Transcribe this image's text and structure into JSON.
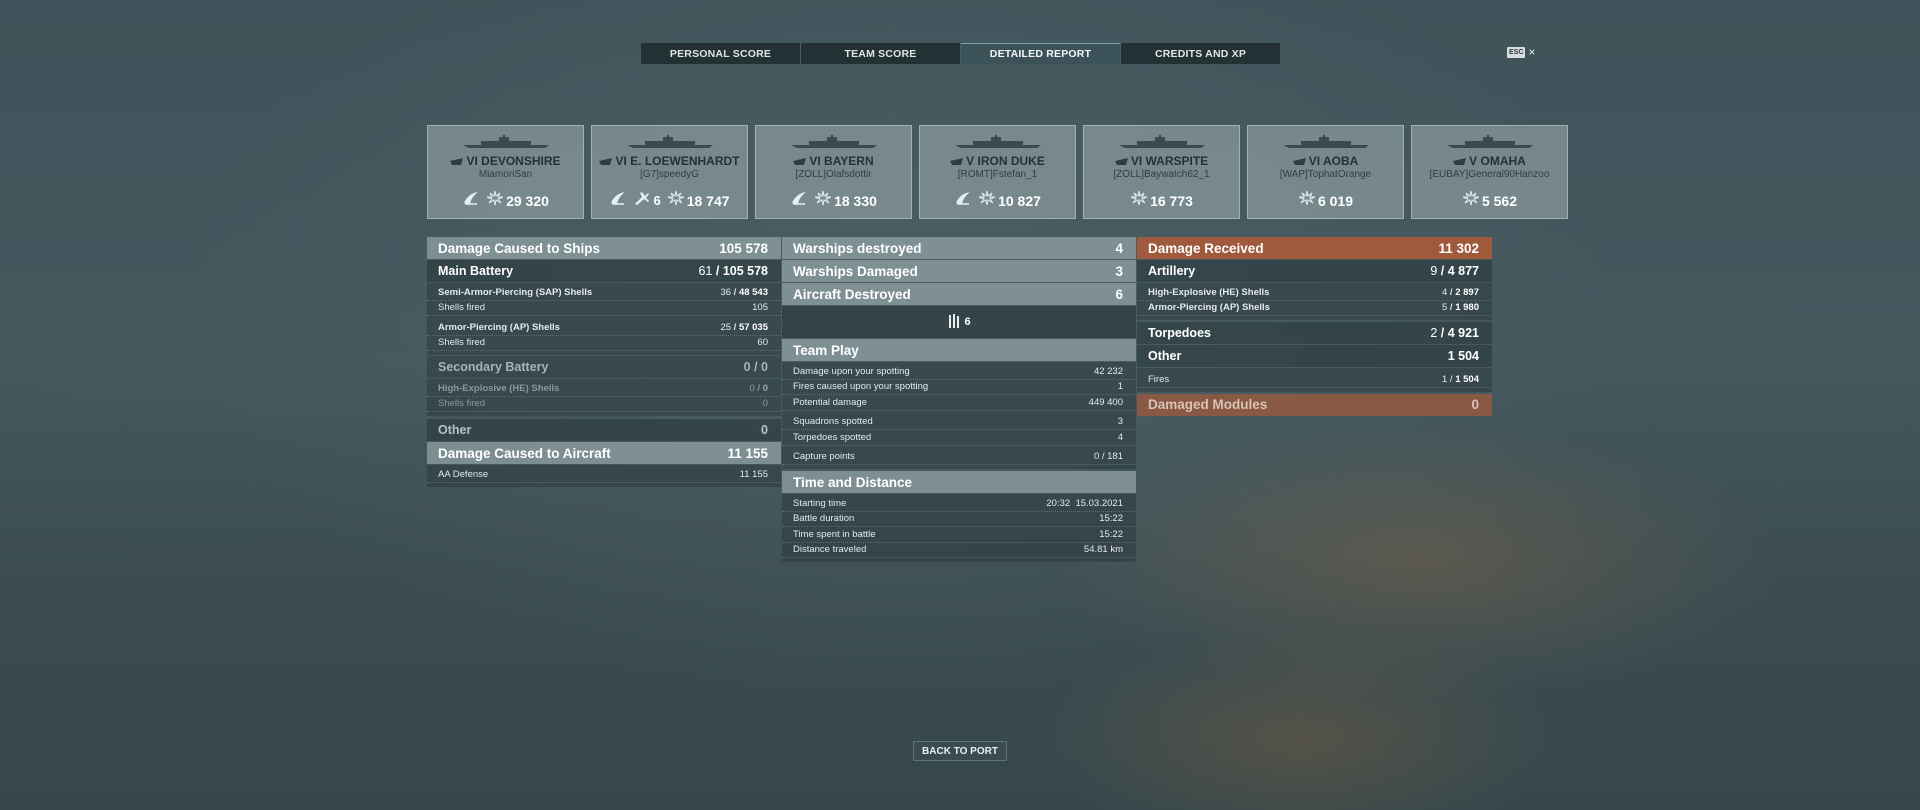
{
  "tabs": [
    "PERSONAL SCORE",
    "TEAM SCORE",
    "DETAILED REPORT",
    "CREDITS AND XP"
  ],
  "active_tab": 2,
  "esc_label": "ESC",
  "close_symbol": "×",
  "ships": [
    {
      "name": "VI DEVONSHIRE",
      "player": "MiamoriSan",
      "score": "29 320",
      "ribbons": [
        {
          "icon": "fire-icon",
          "count": ""
        }
      ]
    },
    {
      "name": "VI E. LOEWENHARDT",
      "player": "[G7]speedyG",
      "score": "18 747",
      "ribbons": [
        {
          "icon": "fire-icon",
          "count": ""
        },
        {
          "icon": "aircraft-icon",
          "count": "6"
        }
      ]
    },
    {
      "name": "VI BAYERN",
      "player": "[ZOLL]Olafsdottir",
      "score": "18 330",
      "ribbons": [
        {
          "icon": "fire-icon",
          "count": ""
        }
      ]
    },
    {
      "name": "V IRON DUKE",
      "player": "[ROMT]Fstefan_1",
      "score": "10 827",
      "ribbons": [
        {
          "icon": "fire-icon",
          "count": ""
        }
      ]
    },
    {
      "name": "VI WARSPITE",
      "player": "[ZOLL]Baywatch62_1",
      "score": "16 773",
      "ribbons": []
    },
    {
      "name": "VI AOBA",
      "player": "[WAP]TophatOrange",
      "score": "6 019",
      "ribbons": []
    },
    {
      "name": "V OMAHA",
      "player": "[EUBAY]General90Hanzoo",
      "score": "5 562",
      "ribbons": []
    }
  ],
  "damage_ships": {
    "label": "Damage Caused to Ships",
    "value": "105 578",
    "main_battery": {
      "label": "Main Battery",
      "hits": "61",
      "dmg": "105 578"
    },
    "sap": {
      "label": "Semi-Armor-Piercing (SAP) Shells",
      "hits": "36",
      "dmg": "48 543",
      "fired_label": "Shells fired",
      "fired": "105"
    },
    "ap": {
      "label": "Armor-Piercing (AP) Shells",
      "hits": "25",
      "dmg": "57 035",
      "fired_label": "Shells fired",
      "fired": "60"
    },
    "secondary": {
      "label": "Secondary Battery",
      "hits": "0",
      "dmg": "0"
    },
    "he": {
      "label": "High-Explosive (HE) Shells",
      "hits": "0",
      "dmg": "0",
      "fired_label": "Shells fired",
      "fired": "0"
    },
    "other": {
      "label": "Other",
      "value": "0"
    }
  },
  "damage_aircraft": {
    "label": "Damage Caused to Aircraft",
    "value": "11 155",
    "aa_label": "AA Defense",
    "aa": "11 155"
  },
  "warships_destroyed": {
    "label": "Warships destroyed",
    "value": "4"
  },
  "warships_damaged": {
    "label": "Warships Damaged",
    "value": "3"
  },
  "aircraft_destroyed": {
    "label": "Aircraft Destroyed",
    "value": "6",
    "ribbon_count": "6"
  },
  "team_play": {
    "label": "Team Play",
    "rows": [
      {
        "label": "Damage upon your spotting",
        "value": "42 232"
      },
      {
        "label": "Fires caused upon your spotting",
        "value": "1"
      },
      {
        "label": "Potential damage",
        "value": "449 400"
      },
      {
        "label": "Squadrons spotted",
        "value": "3"
      },
      {
        "label": "Torpedoes spotted",
        "value": "4"
      },
      {
        "label": "Capture points",
        "value": "0 / 181"
      }
    ]
  },
  "time_distance": {
    "label": "Time and Distance",
    "rows": [
      {
        "label": "Starting time",
        "value": "20:32  15.03.2021"
      },
      {
        "label": "Battle duration",
        "value": "15:22"
      },
      {
        "label": "Time spent in battle",
        "value": "15:22"
      },
      {
        "label": "Distance traveled",
        "value": "54.81 km"
      }
    ]
  },
  "damage_received": {
    "label": "Damage Received",
    "value": "11 302",
    "artillery": {
      "label": "Artillery",
      "hits": "9",
      "dmg": "4 877"
    },
    "he": {
      "label": "High-Explosive (HE) Shells",
      "hits": "4",
      "dmg": "2 897"
    },
    "ap": {
      "label": "Armor-Piercing (AP) Shells",
      "hits": "5",
      "dmg": "1 980"
    },
    "torpedoes": {
      "label": "Torpedoes",
      "hits": "2",
      "dmg": "4 921"
    },
    "other": {
      "label": "Other",
      "value": "1 504"
    },
    "fires": {
      "label": "Fires",
      "hits": "1",
      "dmg": "1 504"
    }
  },
  "damaged_modules": {
    "label": "Damaged Modules",
    "value": "0"
  },
  "back_button": "BACK TO PORT"
}
